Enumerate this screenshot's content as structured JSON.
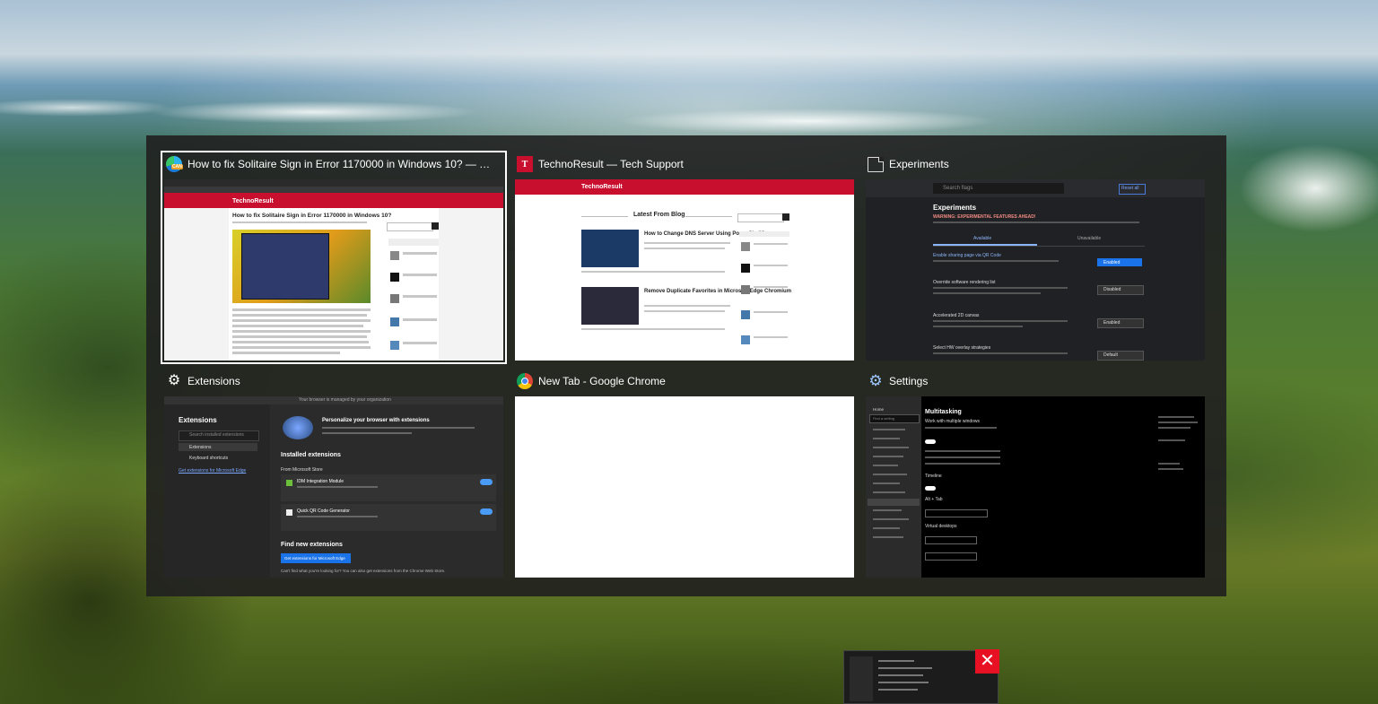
{
  "windows": [
    {
      "title": "How to fix Solitaire Sign in Error 1170000 in Windows 10? — Tech Support a...",
      "icon": "edge-icon",
      "icon_badge": "CAN",
      "selected": true
    },
    {
      "title": "TechnoResult — Tech Support",
      "icon": "technoresult-icon",
      "icon_letter": "T"
    },
    {
      "title": "Experiments",
      "icon": "page-icon"
    },
    {
      "title": "Extensions",
      "icon": "puzzle-icon"
    },
    {
      "title": "New Tab - Google Chrome",
      "icon": "chrome-icon"
    },
    {
      "title": "Settings",
      "icon": "gear-icon"
    }
  ],
  "thumb1": {
    "brand": "TechnoResult",
    "headline": "How to fix Solitaire Sign in Error 1170000 in Windows 10?"
  },
  "thumb2": {
    "brand": "TechnoResult",
    "section": "Latest From Blog",
    "post1": "How to Change DNS Server Using PowerShell?",
    "post2": "Remove Duplicate Favorites in Microsoft Edge Chromium"
  },
  "thumb3": {
    "search_placeholder": "Search flags",
    "reset_label": "Reset all",
    "heading": "Experiments",
    "warning": "WARNING: EXPERIMENTAL FEATURES AHEAD!",
    "tab_available": "Available",
    "tab_unavailable": "Unavailable",
    "flag1": "Enable sharing page via QR Code",
    "flag1_value": "Enabled",
    "flag2": "Override software rendering list",
    "flag2_value": "Disabled",
    "flag3": "Accelerated 2D canvas",
    "flag3_value": "Enabled",
    "flag4": "Select HW overlay strategies",
    "flag4_value": "Default"
  },
  "thumb4": {
    "banner": "Your browser is managed by your organization",
    "heading": "Extensions",
    "search_placeholder": "Search installed extensions",
    "nav_extensions": "Extensions",
    "nav_shortcuts": "Keyboard shortcuts",
    "get_link": "Get extensions for Microsoft Edge",
    "promo_title": "Personalize your browser with extensions",
    "installed": "Installed extensions",
    "from_store": "From Microsoft Store",
    "ext1": "IDM Integration Module",
    "ext2": "Quick QR Code Generator",
    "find": "Find new extensions",
    "get_button": "Get extensions for Microsoft Edge",
    "cant_find": "Can't find what you're looking for? You can also get extensions from the Chrome Web Store."
  },
  "thumb6": {
    "home": "Home",
    "find_placeholder": "Find a setting",
    "heading": "Multitasking",
    "snap": "Work with multiple windows",
    "timeline": "Timeline",
    "alt_tab": "Alt + Tab",
    "virtual": "Virtual desktops"
  },
  "taskbar_close": "✕"
}
